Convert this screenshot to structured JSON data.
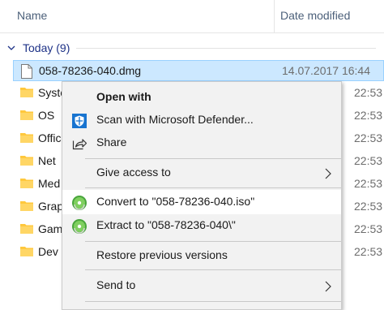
{
  "columns": {
    "name": "Name",
    "date_modified": "Date modified"
  },
  "group": {
    "label": "Today (9)"
  },
  "files": [
    {
      "name": "058-78236-040.dmg",
      "date": "14.07.2017 16:44",
      "type": "file",
      "selected": true
    },
    {
      "name": "Syste",
      "date": "22:53",
      "type": "folder"
    },
    {
      "name": "OS",
      "date": "22:53",
      "type": "folder"
    },
    {
      "name": "Offic",
      "date": "22:53",
      "type": "folder"
    },
    {
      "name": "Net",
      "date": "22:53",
      "type": "folder"
    },
    {
      "name": "Med",
      "date": "22:53",
      "type": "folder"
    },
    {
      "name": "Grap",
      "date": "22:53",
      "type": "folder"
    },
    {
      "name": "Gam",
      "date": "22:53",
      "type": "folder"
    },
    {
      "name": "Dev",
      "date": "22:53",
      "type": "folder"
    }
  ],
  "context_menu": {
    "open_with": "Open with",
    "scan": "Scan with Microsoft Defender...",
    "share": "Share",
    "give_access": "Give access to",
    "convert": "Convert to \"058-78236-040.iso\"",
    "extract": "Extract to \"058-78236-040\\\"",
    "restore": "Restore previous versions",
    "send_to": "Send to"
  },
  "colors": {
    "folder": "#ffc83d",
    "selection": "#cce8ff",
    "defender_blue": "#1874d0",
    "poweriso_green": "#49a53c",
    "group_label": "#1e3287"
  }
}
